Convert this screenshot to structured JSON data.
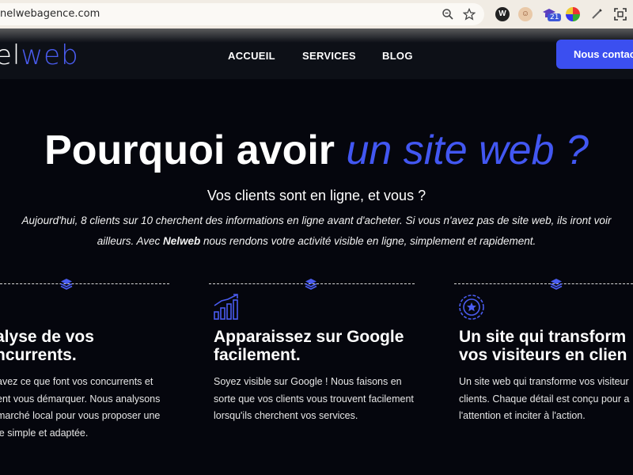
{
  "browser": {
    "url": "nelwebagence.com",
    "zoom_icon": "magnifier-icon",
    "bookmark_icon": "star-icon",
    "extension_badge": "21"
  },
  "header": {
    "logo_part1": "el",
    "logo_part2": "web",
    "nav": [
      "ACCUEIL",
      "SERVICES",
      "BLOG"
    ],
    "contact": "Nous contact"
  },
  "hero": {
    "title_main": "Pourquoi avoir ",
    "title_accent": "un site web ?",
    "subtitle": "Vos clients sont en ligne, et vous ?",
    "desc_line1": "Aujourd'hui, 8 clients sur 10 cherchent des informations en ligne avant d'acheter. Si vous n'avez pas de site web, ils iront voir",
    "desc_line2_pre": "ailleurs. Avec ",
    "desc_brand": "Nelweb",
    "desc_line2_post": " nous rendons votre activité visible en ligne, simplement et rapidement."
  },
  "cards": [
    {
      "icon": "",
      "title_l1": "alyse de vos",
      "title_l2": "ncurrents.",
      "text": [
        "avez ce que font vos concurrents et",
        "ent vous démarquer. Nous analysons",
        "marché local pour vous proposer une",
        "ie simple et adaptée."
      ]
    },
    {
      "icon": "growth-chart-icon",
      "title_l1": "Apparaissez sur Google",
      "title_l2": "facilement.",
      "text": [
        "Soyez visible sur Google ! Nous faisons en",
        "sorte que vos clients vous trouvent facilement",
        "lorsqu'ils cherchent vos services."
      ]
    },
    {
      "icon": "award-badge-icon",
      "title_l1": "Un site qui transform",
      "title_l2": "vos visiteurs en clien",
      "text": [
        "Un site web qui transforme vos visiteur",
        "clients. Chaque détail est conçu pour a",
        "l'attention et inciter à l'action."
      ]
    }
  ],
  "colors": {
    "accent": "#4257f2",
    "background": "#05060d",
    "header_bg": "#0d1017",
    "button": "#3b4ff0"
  }
}
